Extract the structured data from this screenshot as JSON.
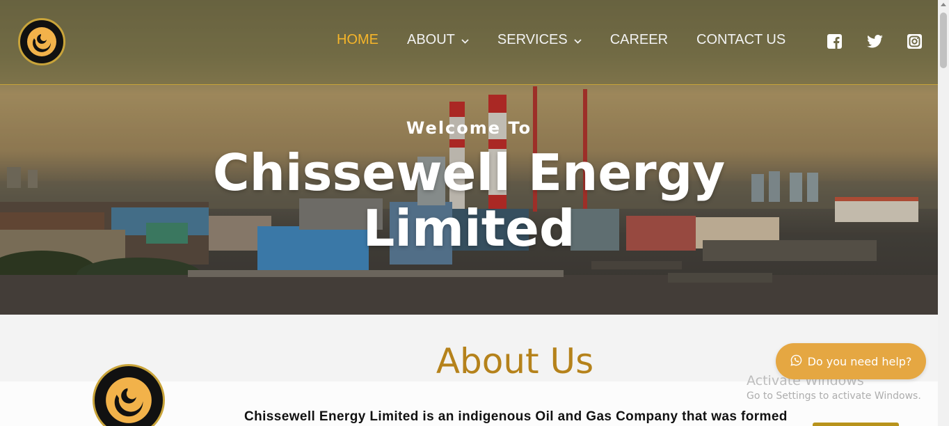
{
  "brand": {
    "logo_name": "chissewell-logo"
  },
  "nav": {
    "items": [
      {
        "label": "HOME",
        "active": true,
        "dropdown": false
      },
      {
        "label": "ABOUT",
        "active": false,
        "dropdown": true
      },
      {
        "label": "SERVICES",
        "active": false,
        "dropdown": true
      },
      {
        "label": "CAREER",
        "active": false,
        "dropdown": false
      },
      {
        "label": "CONTACT US",
        "active": false,
        "dropdown": false
      }
    ],
    "social": [
      "facebook-icon",
      "twitter-icon",
      "instagram-icon"
    ]
  },
  "hero": {
    "welcome": "Welcome To",
    "title_line1": "Chissewell Energy",
    "title_line2": "Limited"
  },
  "about": {
    "heading": "About Us",
    "text": "Chissewell Energy Limited is an indigenous Oil and Gas Company that was formed"
  },
  "help_button": {
    "label": "Do you need help?",
    "icon": "whatsapp-icon"
  },
  "watermark": {
    "line1": "Activate Windows",
    "line2": "Go to Settings to activate Windows."
  },
  "colors": {
    "accent": "#f6b52a",
    "heading_gold": "#b5821b",
    "help_button": "#e5a742"
  }
}
